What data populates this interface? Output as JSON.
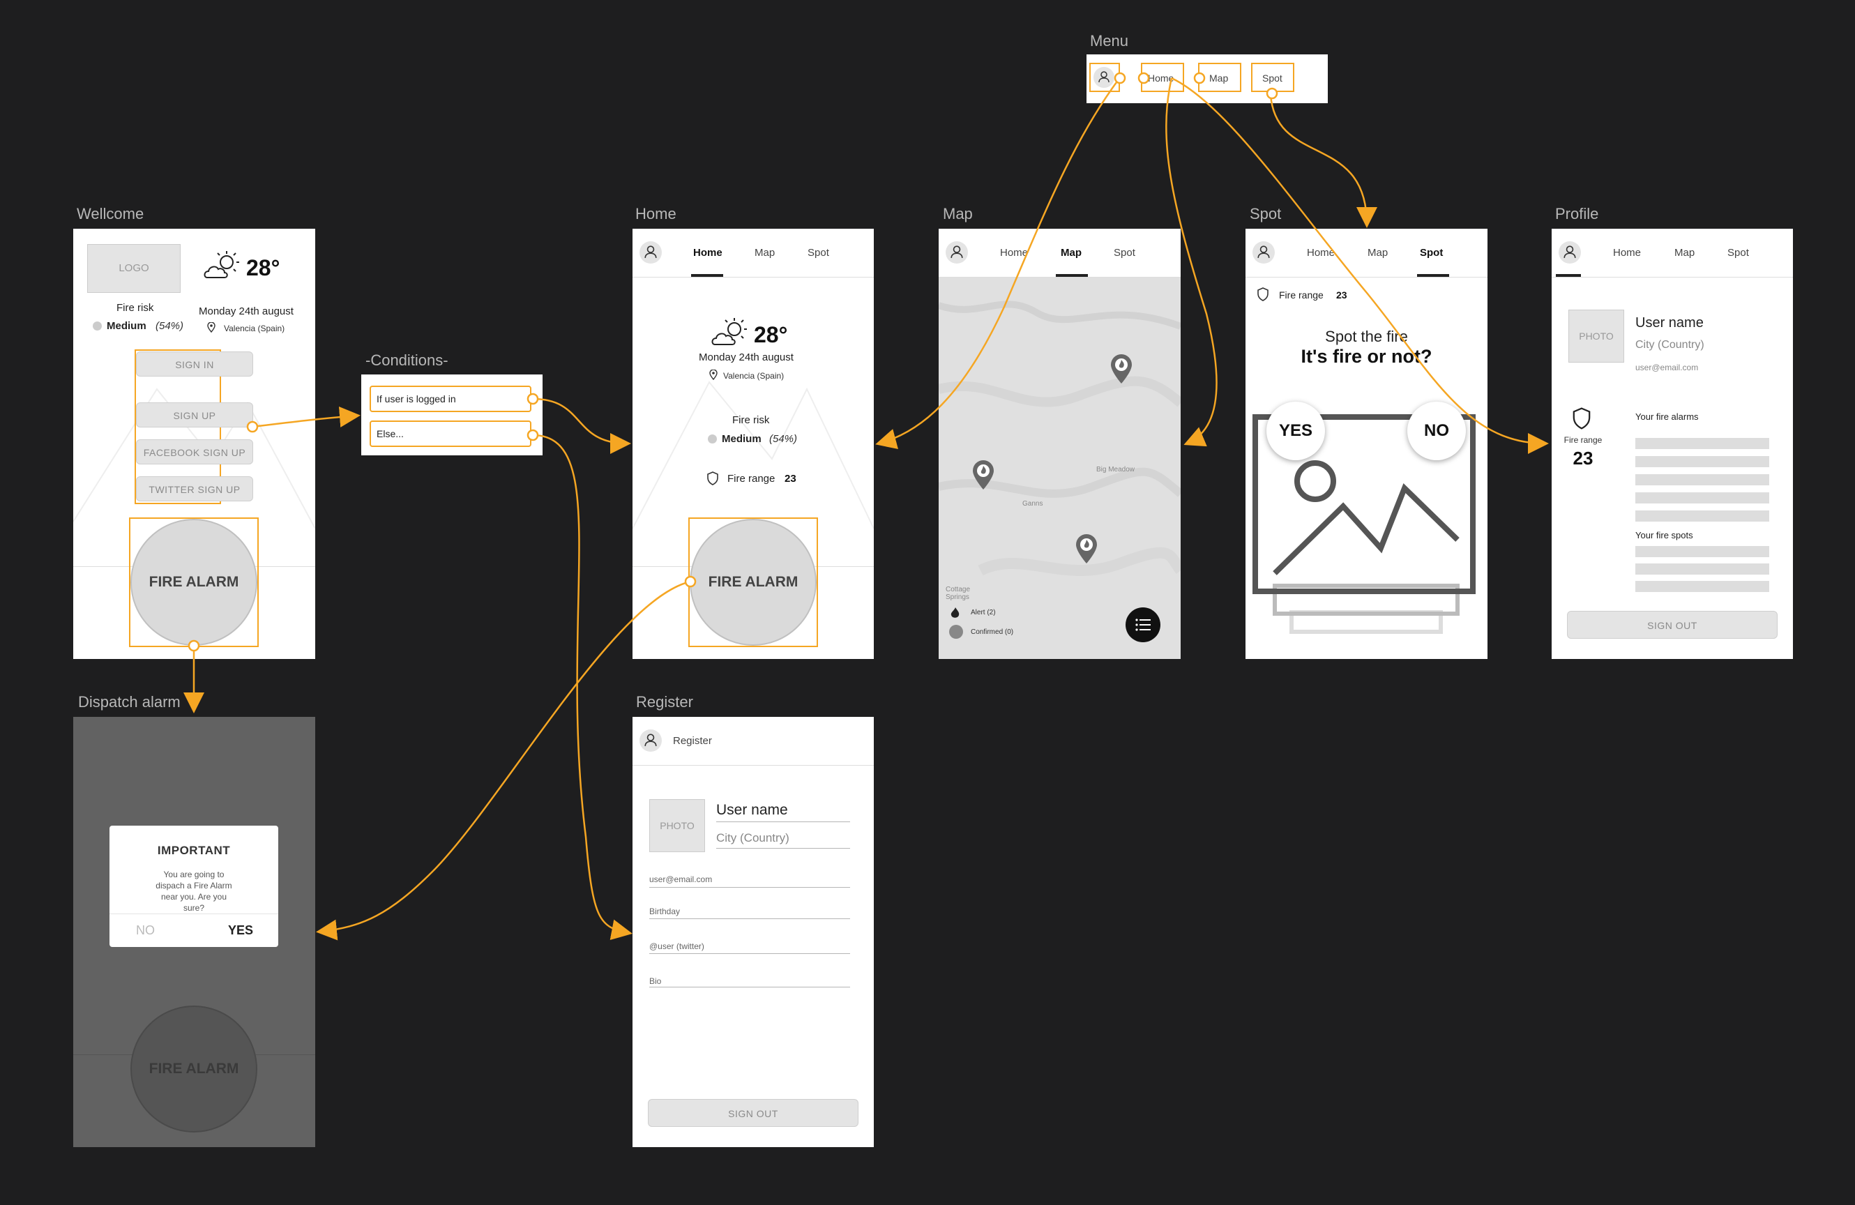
{
  "labels": {
    "menu": "Menu",
    "welcome": "Wellcome",
    "conditions": "-Conditions-",
    "home": "Home",
    "map": "Map",
    "spot": "Spot",
    "profile": "Profile",
    "dispatch": "Dispatch alarm",
    "register": "Register"
  },
  "menu": {
    "home": "Home",
    "map": "Map",
    "spot": "Spot"
  },
  "nav": {
    "home": "Home",
    "map": "Map",
    "spot": "Spot"
  },
  "welcome": {
    "logo": "LOGO",
    "temp": "28°",
    "fire_risk_label": "Fire risk",
    "risk_value": "Medium",
    "risk_pct": "(54%)",
    "date": "Monday 24th august",
    "location": "Valencia (Spain)",
    "sign_in": "SIGN IN",
    "sign_up": "SIGN UP",
    "facebook": "FACEBOOK SIGN UP",
    "twitter": "TWITTER SIGN UP",
    "fire_alarm": "FIRE ALARM"
  },
  "conditions": {
    "logged": "If user is logged in",
    "else": "Else..."
  },
  "home": {
    "temp": "28°",
    "date": "Monday 24th august",
    "location": "Valencia (Spain)",
    "fire_risk_label": "Fire risk",
    "risk_value": "Medium",
    "risk_pct": "(54%)",
    "fire_range_label": "Fire range",
    "fire_range_value": "23",
    "fire_alarm": "FIRE ALARM"
  },
  "map": {
    "place_big_meadow": "Big Meadow",
    "place_ganns": "Ganns",
    "place_cottage": "Cottage Springs",
    "legend_alert": "Alert (2)",
    "legend_confirmed": "Confirmed (0)"
  },
  "spot": {
    "fire_range_label": "Fire range",
    "fire_range_value": "23",
    "title": "Spot the fire",
    "question": "It's fire or not?",
    "yes": "YES",
    "no": "NO"
  },
  "profile": {
    "photo": "PHOTO",
    "user_name": "User name",
    "city": "City (Country)",
    "email": "user@email.com",
    "fire_range_label": "Fire range",
    "fire_range_value": "23",
    "alarms_title": "Your fire alarms",
    "spots_title": "Your fire spots",
    "sign_out": "SIGN OUT"
  },
  "dispatch": {
    "title": "IMPORTANT",
    "message": "You are going to dispach a Fire Alarm near you. Are you sure?",
    "no": "NO",
    "yes": "YES",
    "fire_alarm": "FIRE ALARM"
  },
  "register": {
    "header": "Register",
    "photo": "PHOTO",
    "user_name": "User name",
    "city": "City (Country)",
    "email": "user@email.com",
    "birthday": "Birthday",
    "twitter": "@user (twitter)",
    "bio": "Bio",
    "sign_out": "SIGN OUT"
  },
  "colors": {
    "accent": "#f5a623",
    "canvas": "#1e1e1f"
  }
}
